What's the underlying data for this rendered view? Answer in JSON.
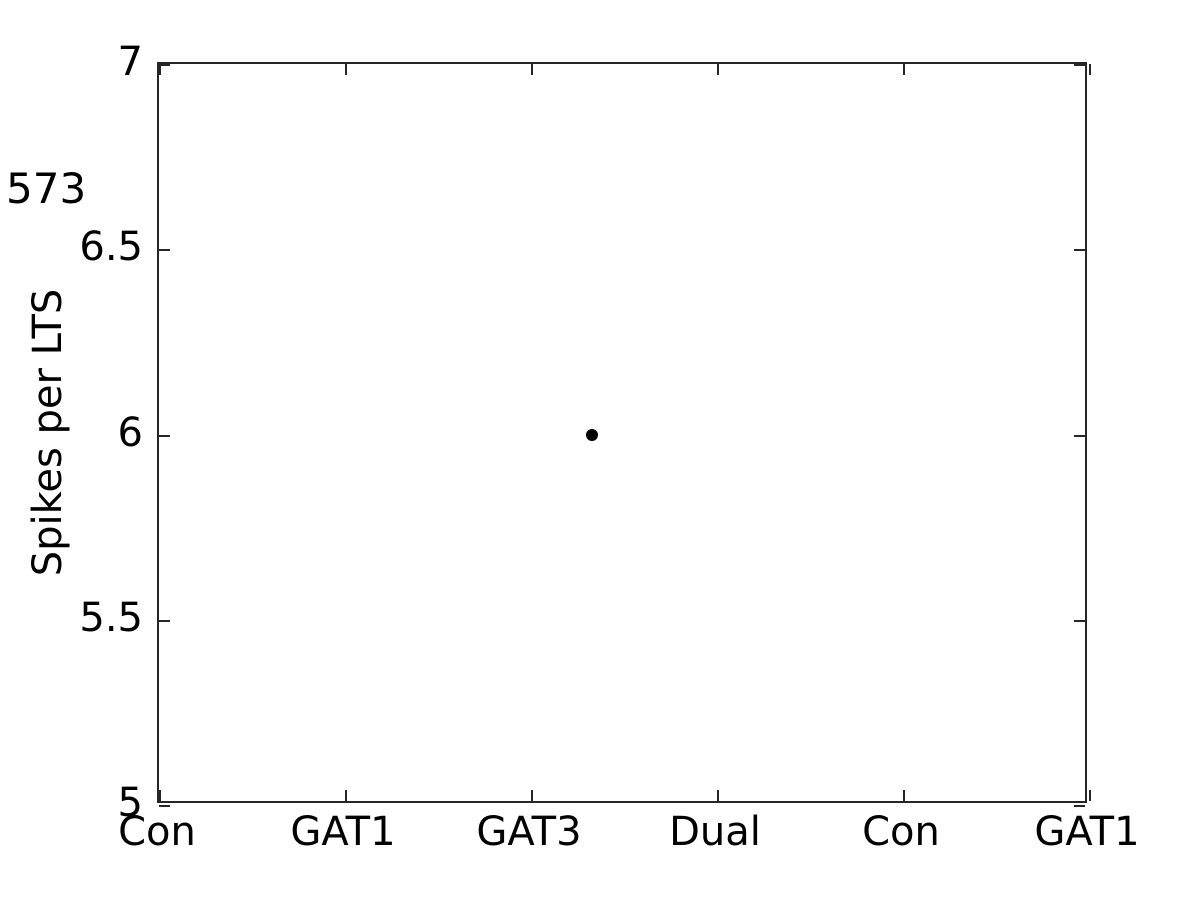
{
  "figure": {
    "corner_label": "573",
    "background_color": "#ffffff",
    "axis_color": "#262626",
    "marker_color": "#000000"
  },
  "chart_data": {
    "type": "scatter",
    "title": "",
    "subtitle": "",
    "xlabel": "",
    "ylabel": "Spikes per LTS",
    "categories": [
      "Con",
      "GAT1",
      "GAT3",
      "Dual",
      "Con",
      "GAT1"
    ],
    "xtick_labels": [
      "Con",
      "GAT1",
      "GAT3",
      "Dual",
      "Con",
      "GAT1"
    ],
    "xtick_values": [
      1,
      2,
      3,
      4,
      5,
      6
    ],
    "xlim": [
      1,
      6
    ],
    "ytick_labels": [
      "5",
      "5.5",
      "6",
      "6.5",
      "7"
    ],
    "ytick_values": [
      5,
      5.5,
      6,
      6.5,
      7
    ],
    "ylim": [
      5,
      7
    ],
    "grid": false,
    "legend": null,
    "points": [
      {
        "x": 3.33,
        "y": 6
      }
    ],
    "series": [
      {
        "name": "Spikes per LTS",
        "x": [
          3.33
        ],
        "values": [
          6
        ]
      }
    ],
    "annotations": [
      {
        "text": "573",
        "position": "outside-top-left"
      }
    ]
  }
}
